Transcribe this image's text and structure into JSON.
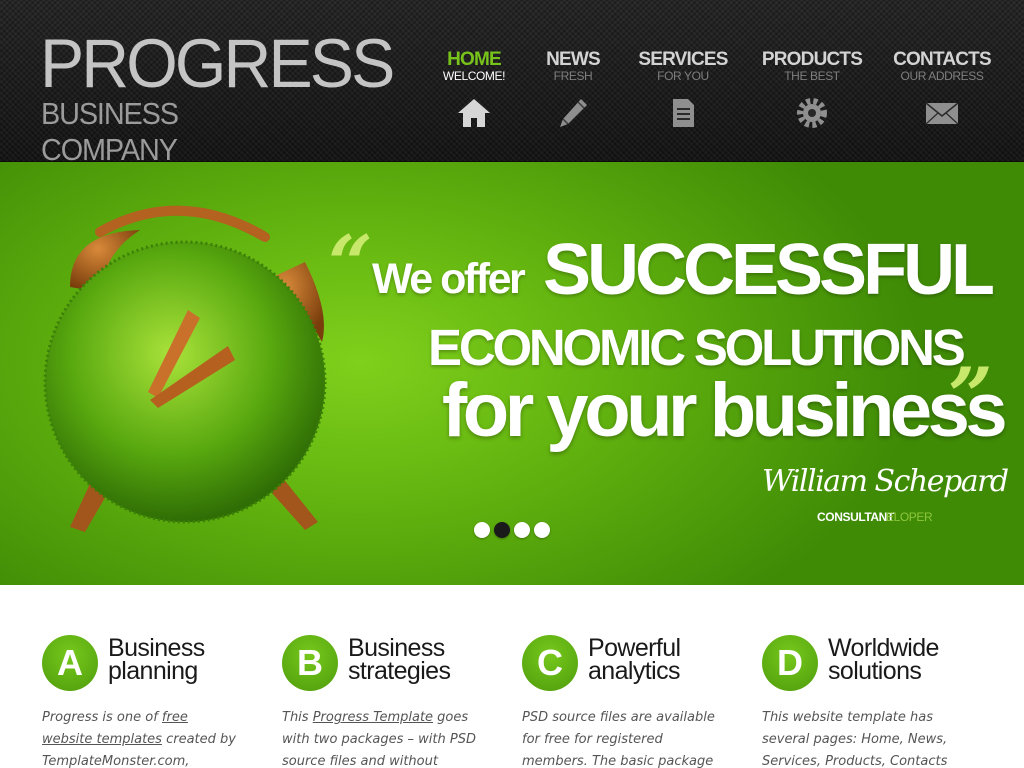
{
  "header": {
    "logo_title": "PROGRESS",
    "logo_subtitle": "BUSINESS COMPANY"
  },
  "nav": {
    "items": [
      {
        "title": "HOME",
        "subtitle": "WELCOME!",
        "icon": "home-icon",
        "active": true
      },
      {
        "title": "NEWS",
        "subtitle": "FRESH",
        "icon": "pencil-icon",
        "active": false
      },
      {
        "title": "SERVICES",
        "subtitle": "FOR YOU",
        "icon": "document-icon",
        "active": false
      },
      {
        "title": "PRODUCTS",
        "subtitle": "THE BEST",
        "icon": "gear-icon",
        "active": false
      },
      {
        "title": "CONTACTS",
        "subtitle": "OUR ADDRESS",
        "icon": "envelope-icon",
        "active": false
      }
    ]
  },
  "hero": {
    "quote_open": "“",
    "quote_close": "”",
    "line1_small": "We offer",
    "line1_big": "SUCCESSFUL",
    "line2": "ECONOMIC SOLUTIONS",
    "line3": "for your business",
    "signature": "William Schepard",
    "role": "CONSULTANT",
    "role_ghost": "ELOPER",
    "slides": [
      {
        "active": false
      },
      {
        "active": true
      },
      {
        "active": false
      },
      {
        "active": false
      }
    ]
  },
  "features": [
    {
      "letter": "A",
      "title_line1": "Business",
      "title_line2": "planning",
      "text_pre": "Progress is one of ",
      "link1": "free",
      "link2": "website templates",
      "text_post": " created by TemplateMonster.com,"
    },
    {
      "letter": "B",
      "title_line1": "Business",
      "title_line2": "strategies",
      "text_pre": "This ",
      "link1": "Progress Template",
      "text_post": " goes with two packages – with PSD source files and without"
    },
    {
      "letter": "C",
      "title_line1": "Powerful",
      "title_line2": "analytics",
      "text": "PSD source files are available for free for registered members. The basic package"
    },
    {
      "letter": "D",
      "title_line1": "Worldwide",
      "title_line2": "solutions",
      "text": "This website template has several pages: Home, News, Services, Products, Contacts"
    }
  ],
  "colors": {
    "accent_green": "#78c21c",
    "header_bg": "#1e1e1e",
    "hero_green": "#62b30f"
  }
}
